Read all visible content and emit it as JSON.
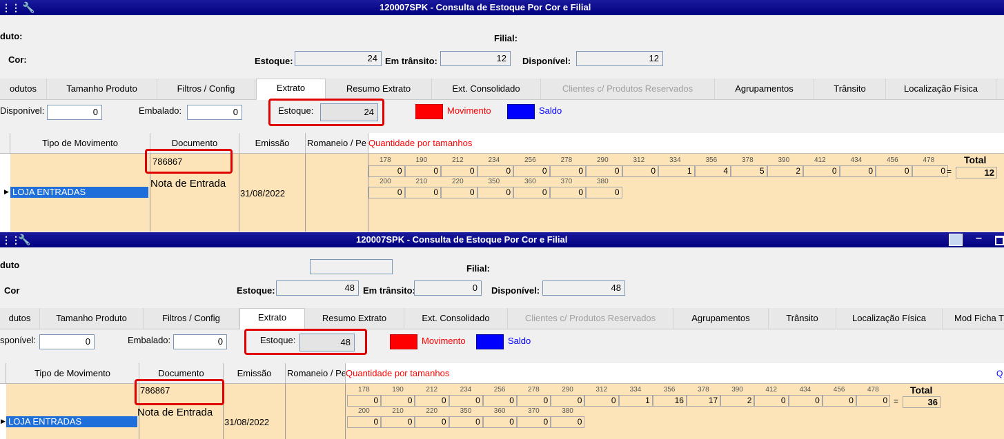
{
  "top": {
    "title": "120007SPK - Consulta de Estoque Por Cor e Filial",
    "produto_label": "duto:",
    "cor_label": "Cor:",
    "filial_label": "Filial:",
    "estoque_label": "Estoque:",
    "estoque_value": "24",
    "transito_label": "Em trânsito:",
    "transito_value": "12",
    "disponivel_label": "Disponível:",
    "disponivel_value": "12",
    "tabs": [
      "odutos",
      "Tamanho Produto",
      "Filtros / Config",
      "Extrato",
      "Resumo Extrato",
      "Ext. Consolidado",
      "Clientes c/ Produtos Reservados",
      "Agrupamentos",
      "Trânsito",
      "Localização Física"
    ],
    "disp_label": "Disponível:",
    "disp_value": "0",
    "embalado_label": "Embalado:",
    "embalado_value": "0",
    "estoque2_label": "Estoque:",
    "estoque2_value": "24",
    "movimento_label": "Movimento",
    "saldo_label": "Saldo",
    "columns": [
      "Tipo de Movimento",
      "Documento",
      "Emissão",
      "Romaneio / Pe"
    ],
    "qty_label": "Quantidade por tamanhos",
    "row": {
      "tipo": "LOJA ENTRADAS",
      "documento": "786867",
      "doc_tipo": "Nota de Entrada",
      "emissao": "31/08/2022"
    },
    "sizes1": [
      "178",
      "190",
      "212",
      "234",
      "256",
      "278",
      "290",
      "312",
      "334",
      "356",
      "378",
      "390",
      "412",
      "434",
      "456",
      "478"
    ],
    "qty1": [
      "0",
      "0",
      "0",
      "0",
      "0",
      "0",
      "0",
      "0",
      "1",
      "4",
      "5",
      "2",
      "0",
      "0",
      "0",
      "0"
    ],
    "sizes2": [
      "200",
      "210",
      "220",
      "350",
      "360",
      "370",
      "380"
    ],
    "qty2": [
      "0",
      "0",
      "0",
      "0",
      "0",
      "0",
      "0"
    ],
    "total_label": "Total",
    "total_value": "12",
    "equals": "="
  },
  "bottom": {
    "title": "120007SPK - Consulta de Estoque Por Cor e Filial",
    "produto_label": "duto",
    "cor_label": "Cor",
    "filial_label": "Filial:",
    "estoque_label": "Estoque:",
    "estoque_value": "48",
    "transito_label": "Em trânsito:",
    "transito_value": "0",
    "disponivel_label": "Disponível:",
    "disponivel_value": "48",
    "tabs": [
      "dutos",
      "Tamanho Produto",
      "Filtros / Config",
      "Extrato",
      "Resumo Extrato",
      "Ext. Consolidado",
      "Clientes c/ Produtos Reservados",
      "Agrupamentos",
      "Trânsito",
      "Localização Física",
      "Mod Ficha T"
    ],
    "disp_label": "sponível:",
    "disp_value": "0",
    "embalado_label": "Embalado:",
    "embalado_value": "0",
    "estoque2_label": "Estoque:",
    "estoque2_value": "48",
    "movimento_label": "Movimento",
    "saldo_label": "Saldo",
    "columns": [
      "Tipo de Movimento",
      "Documento",
      "Emissão",
      "Romaneio / Pe"
    ],
    "qty_label": "Quantidade por tamanhos",
    "row": {
      "tipo": "LOJA ENTRADAS",
      "documento": "786867",
      "doc_tipo": "Nota de Entrada",
      "emissao": "31/08/2022"
    },
    "sizes1": [
      "178",
      "190",
      "212",
      "234",
      "256",
      "278",
      "290",
      "312",
      "334",
      "356",
      "378",
      "390",
      "412",
      "434",
      "456",
      "478"
    ],
    "qty1": [
      "0",
      "0",
      "0",
      "0",
      "0",
      "0",
      "0",
      "0",
      "1",
      "16",
      "17",
      "2",
      "0",
      "0",
      "0",
      "0"
    ],
    "sizes2": [
      "200",
      "210",
      "220",
      "350",
      "360",
      "370",
      "380"
    ],
    "qty2": [
      "0",
      "0",
      "0",
      "0",
      "0",
      "0",
      "0"
    ],
    "total_label": "Total",
    "total_value": "36",
    "equals": "=",
    "q_glyph": "Q"
  },
  "colors": {
    "title_bar": "#000080",
    "row_bg": "#fce4b8",
    "selection": "#1e6fd9",
    "movimento": "#ff0000",
    "saldo": "#0000ff",
    "highlight": "#e00000"
  }
}
